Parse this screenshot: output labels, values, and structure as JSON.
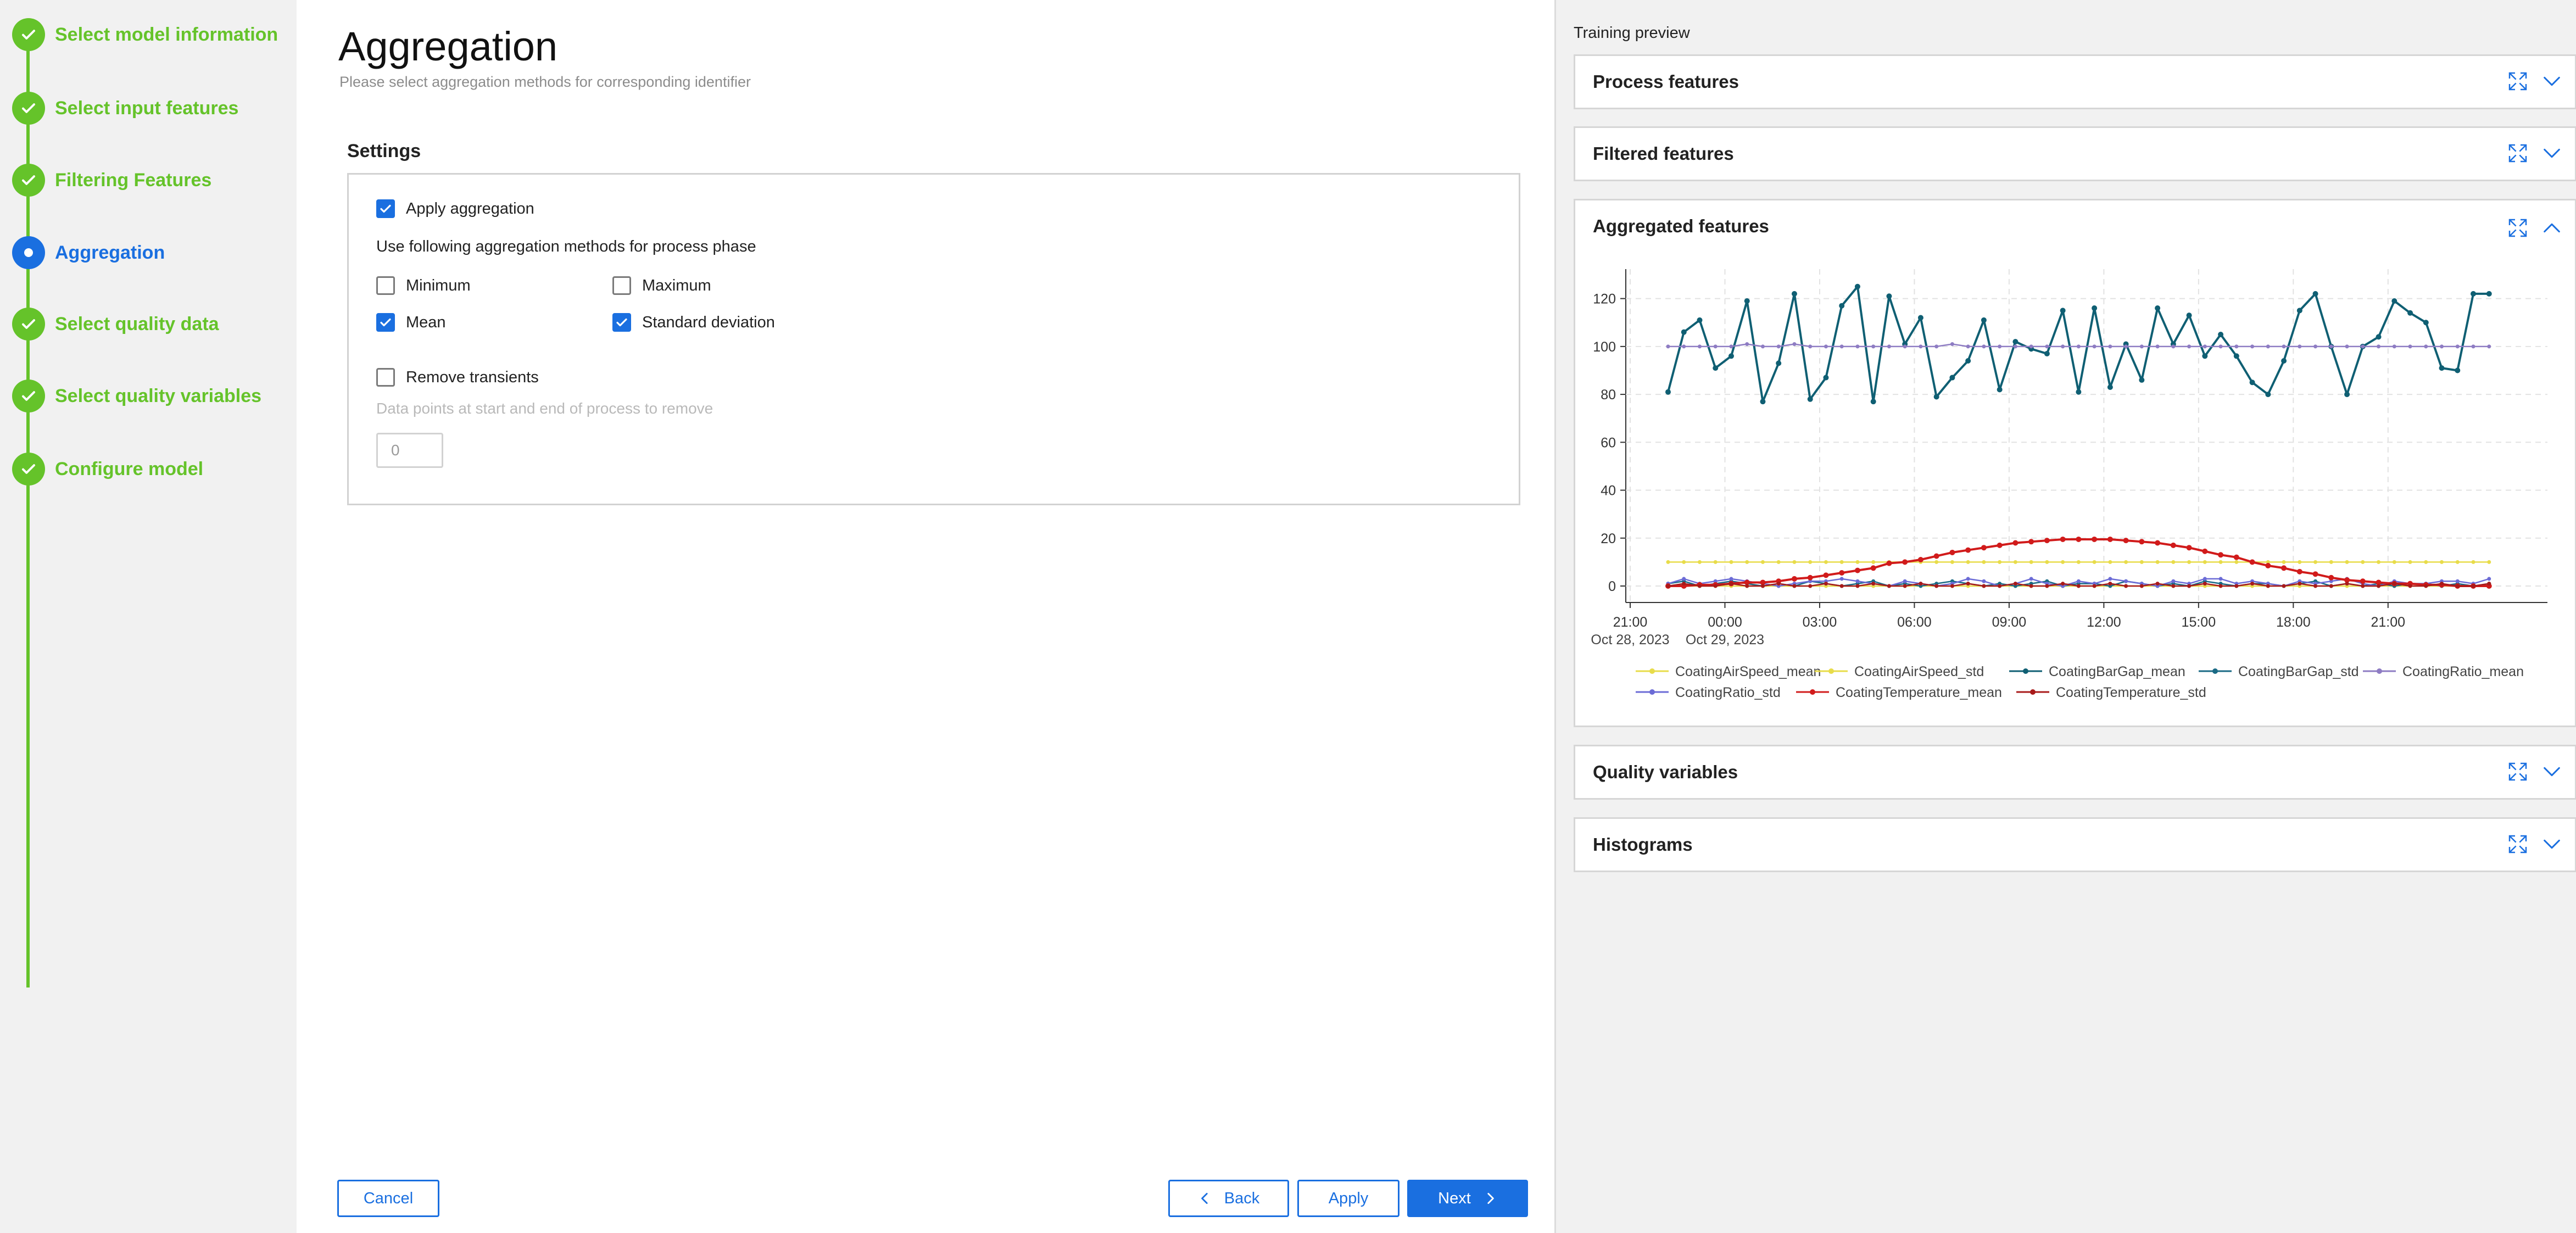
{
  "stepper": {
    "steps": [
      {
        "label": "Select model information",
        "state": "done"
      },
      {
        "label": "Select input features",
        "state": "done"
      },
      {
        "label": "Filtering Features",
        "state": "done"
      },
      {
        "label": "Aggregation",
        "state": "active"
      },
      {
        "label": "Select quality data",
        "state": "done"
      },
      {
        "label": "Select quality variables",
        "state": "done"
      },
      {
        "label": "Configure model",
        "state": "done"
      }
    ]
  },
  "main": {
    "title": "Aggregation",
    "subtitle": "Please select aggregation methods for corresponding identifier",
    "settings_heading": "Settings",
    "apply_aggregation": {
      "label": "Apply aggregation",
      "checked": true
    },
    "methods_heading": "Use following aggregation methods for process phase",
    "methods": [
      {
        "label": "Minimum",
        "checked": false
      },
      {
        "label": "Maximum",
        "checked": false
      },
      {
        "label": "Mean",
        "checked": true
      },
      {
        "label": "Standard deviation",
        "checked": true
      }
    ],
    "remove_transients": {
      "label": "Remove transients",
      "checked": false
    },
    "remove_help": "Data points at start and end of process to remove",
    "remove_value": "0"
  },
  "footer": {
    "cancel": "Cancel",
    "back": "Back",
    "apply": "Apply",
    "next": "Next"
  },
  "right": {
    "title": "Training preview",
    "panels": [
      {
        "title": "Process features",
        "expanded": false
      },
      {
        "title": "Filtered features",
        "expanded": false
      },
      {
        "title": "Aggregated features",
        "expanded": true
      },
      {
        "title": "Quality variables",
        "expanded": false
      },
      {
        "title": "Histograms",
        "expanded": false
      }
    ]
  },
  "colors": {
    "accent": "#1a6fe0",
    "success": "#65c32a"
  },
  "chart_data": {
    "type": "line",
    "title": "",
    "xlabel": "",
    "ylabel": "",
    "ylim": [
      0,
      130
    ],
    "yticks": [
      0,
      20,
      40,
      60,
      80,
      100,
      120
    ],
    "xtick_labels": [
      "21:00",
      "00:00",
      "03:00",
      "06:00",
      "09:00",
      "12:00",
      "15:00",
      "18:00",
      "21:00"
    ],
    "xtick_sublabels": [
      "Oct 28, 2023",
      "Oct 29, 2023",
      "",
      "",
      "",
      "",
      "",
      "",
      ""
    ],
    "x_start_hour": 22.2,
    "x_step_hours": 0.5,
    "legend_position": "bottom",
    "grid": true,
    "series": [
      {
        "name": "CoatingAirSpeed_mean",
        "color": "#e8dc4a",
        "values": [
          10,
          10,
          10,
          10,
          10,
          10,
          10,
          10,
          10,
          10,
          10,
          10,
          10,
          10,
          10,
          10,
          10,
          10,
          10,
          10,
          10,
          10,
          10,
          10,
          10,
          10,
          10,
          10,
          10,
          10,
          10,
          10,
          10,
          10,
          10,
          10,
          10,
          10,
          10,
          10,
          10,
          10,
          10,
          10,
          10,
          10,
          10,
          10,
          10,
          10,
          10,
          10,
          10
        ]
      },
      {
        "name": "CoatingAirSpeed_std",
        "color": "#e8dc4a",
        "values": [
          0,
          0,
          0,
          0,
          0,
          0,
          0,
          0,
          0,
          0,
          0,
          0,
          0,
          0,
          0,
          0,
          0,
          0,
          0,
          0,
          0,
          0,
          0,
          0,
          0,
          0,
          0,
          0,
          0,
          0,
          0,
          0,
          0,
          0,
          0,
          0,
          0,
          0,
          0,
          0,
          0,
          0,
          0,
          0,
          0,
          0,
          0,
          0,
          0,
          0,
          0,
          0,
          0
        ]
      },
      {
        "name": "CoatingBarGap_mean",
        "color": "#0f5f73",
        "values": [
          81,
          106,
          111,
          91,
          96,
          119,
          77,
          93,
          122,
          78,
          87,
          117,
          125,
          77,
          121,
          101,
          112,
          79,
          87,
          94,
          111,
          82,
          102,
          99,
          97,
          115,
          81,
          116,
          83,
          101,
          86,
          116,
          101,
          113,
          96,
          105,
          96,
          85,
          80,
          94,
          115,
          122,
          100,
          80,
          100,
          104,
          119,
          114,
          110,
          91,
          90,
          122,
          122
        ]
      },
      {
        "name": "CoatingBarGap_std",
        "color": "#1a6a85",
        "values": [
          1,
          2,
          0,
          1,
          2,
          1,
          0,
          1,
          0,
          2,
          1,
          0,
          1,
          2,
          0,
          1,
          0,
          1,
          2,
          1,
          0,
          1,
          0,
          1,
          2,
          0,
          1,
          1,
          0,
          2,
          1,
          0,
          1,
          0,
          2,
          1,
          0,
          1,
          1,
          0,
          1,
          2,
          0,
          1,
          0,
          1,
          0,
          1,
          1,
          0,
          1,
          0,
          1
        ]
      },
      {
        "name": "CoatingRatio_mean",
        "color": "#8e7cc3",
        "values": [
          100,
          100,
          100,
          100,
          100,
          101,
          100,
          100,
          101,
          100,
          100,
          100,
          100,
          100,
          100,
          100,
          100,
          100,
          101,
          100,
          100,
          100,
          100,
          100,
          100,
          100,
          100,
          100,
          100,
          100,
          100,
          100,
          100,
          100,
          100,
          100,
          100,
          100,
          100,
          100,
          100,
          100,
          100,
          100,
          100,
          100,
          100,
          100,
          100,
          100,
          100,
          100,
          100
        ]
      },
      {
        "name": "CoatingRatio_std",
        "color": "#6b6bd6",
        "values": [
          1,
          3,
          1,
          2,
          3,
          2,
          1,
          0,
          1,
          2,
          2,
          3,
          2,
          1,
          0,
          2,
          1,
          0,
          1,
          3,
          2,
          0,
          1,
          3,
          1,
          0,
          2,
          1,
          3,
          2,
          1,
          0,
          2,
          1,
          3,
          3,
          1,
          2,
          1,
          0,
          2,
          1,
          2,
          3,
          1,
          0,
          2,
          1,
          1,
          2,
          2,
          1,
          3
        ]
      },
      {
        "name": "CoatingTemperature_mean",
        "color": "#d11b1b",
        "values": [
          0,
          0,
          0.5,
          0.5,
          1,
          1.5,
          1.5,
          2,
          3,
          3.5,
          4.5,
          5.5,
          6.5,
          7.5,
          9.5,
          10,
          11,
          12.5,
          14,
          15,
          16,
          17,
          18,
          18.5,
          19,
          19.5,
          19.5,
          19.5,
          19.5,
          19,
          18.5,
          18,
          17,
          16,
          14.5,
          13,
          12,
          10,
          8.5,
          7.5,
          6,
          5,
          3.5,
          2.5,
          2,
          1.5,
          1,
          1,
          0.5,
          0.5,
          0,
          0,
          0
        ]
      },
      {
        "name": "CoatingTemperature_std",
        "color": "#a81a1a",
        "values": [
          0,
          1,
          0,
          0,
          1,
          0,
          0,
          1,
          0,
          0,
          1,
          0,
          0,
          1,
          0,
          0,
          1,
          0,
          0,
          1,
          0,
          0,
          1,
          0,
          0,
          1,
          0,
          0,
          1,
          0,
          0,
          1,
          0,
          0,
          1,
          0,
          0,
          1,
          0,
          0,
          1,
          0,
          0,
          1,
          0,
          0,
          1,
          0,
          0,
          1,
          0,
          0,
          1
        ]
      }
    ]
  }
}
